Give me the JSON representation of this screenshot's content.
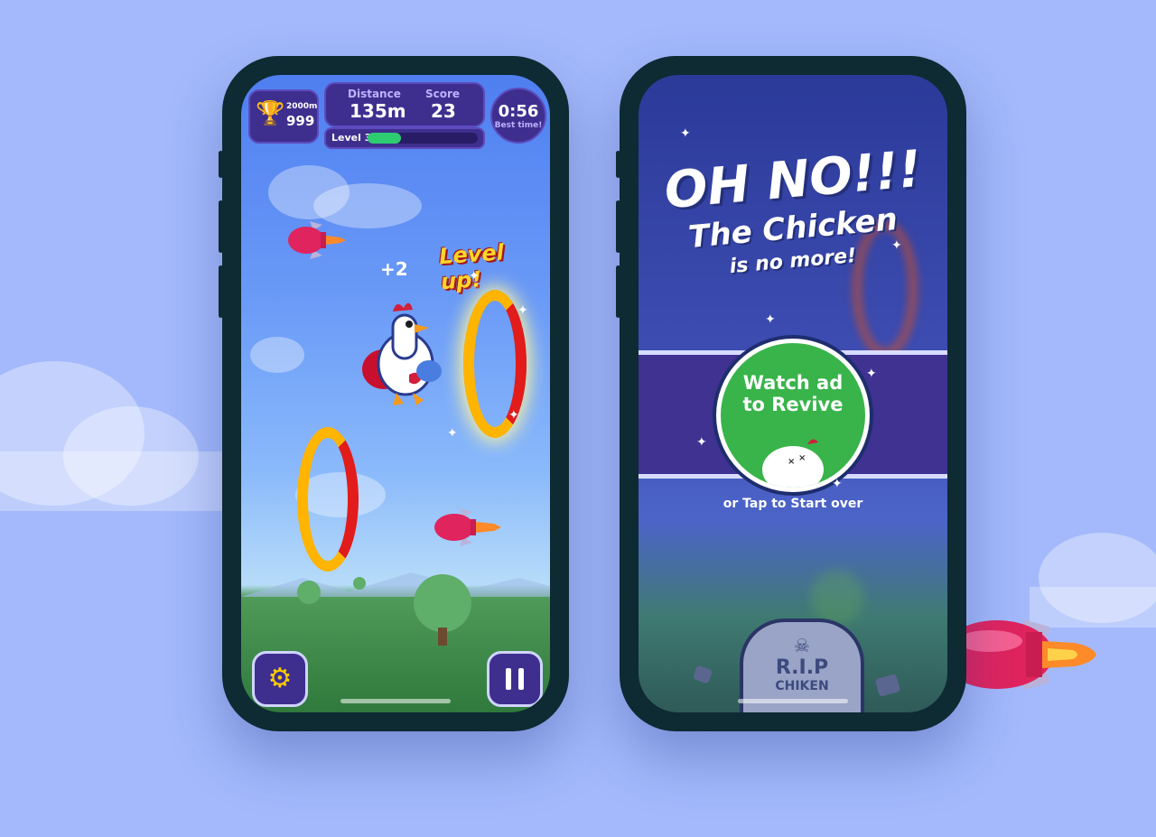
{
  "colors": {
    "background": "#a3b9fb",
    "phone_frame": "#0e2a33",
    "hud_panel": "#3e2f8f",
    "progress_fill": "#2ecc71",
    "revive_green": "#38b44a",
    "banner": "#3f3291"
  },
  "game_screen": {
    "trophy": {
      "icon": "trophy-icon",
      "distance_record": "2000m",
      "score_record": "999"
    },
    "distance": {
      "label": "Distance",
      "value": "135m"
    },
    "score": {
      "label": "Score",
      "value": "23"
    },
    "level": {
      "label": "Level 3",
      "progress": 0.3
    },
    "timer": {
      "value": "0:56",
      "caption": "Best time!"
    },
    "bonus_text": "+2",
    "level_up_text": "Level up!",
    "settings_icon": "gear-icon",
    "pause_icon": "pause-icon"
  },
  "game_over_screen": {
    "headline": "OH NO!!!",
    "subline": "The Chicken",
    "subline2": "is no more!",
    "revive_button": {
      "line1": "Watch ad",
      "line2": "to Revive"
    },
    "restart_hint": "or Tap to Start over",
    "tombstone": {
      "line1": "R.I.P",
      "line2": "CHIKEN"
    }
  }
}
